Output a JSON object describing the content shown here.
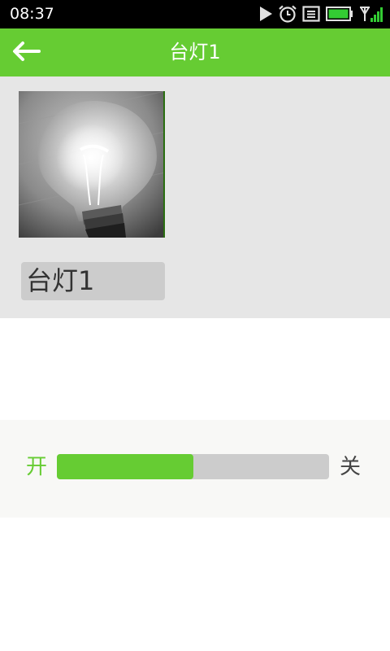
{
  "status_bar": {
    "time": "08:37",
    "icons": [
      "play-icon",
      "alarm-icon",
      "notes-icon",
      "battery-icon",
      "signal-icon"
    ]
  },
  "app_bar": {
    "title": "台灯1",
    "back_icon": "back-arrow-icon"
  },
  "device": {
    "image": "light-bulb-photo",
    "name": "台灯1"
  },
  "control": {
    "on_label": "开",
    "off_label": "关",
    "level_fraction": 0.5
  },
  "colors": {
    "accent": "#66cc33",
    "panel_gray": "#e6e6e6",
    "track_gray": "#cccccc"
  }
}
